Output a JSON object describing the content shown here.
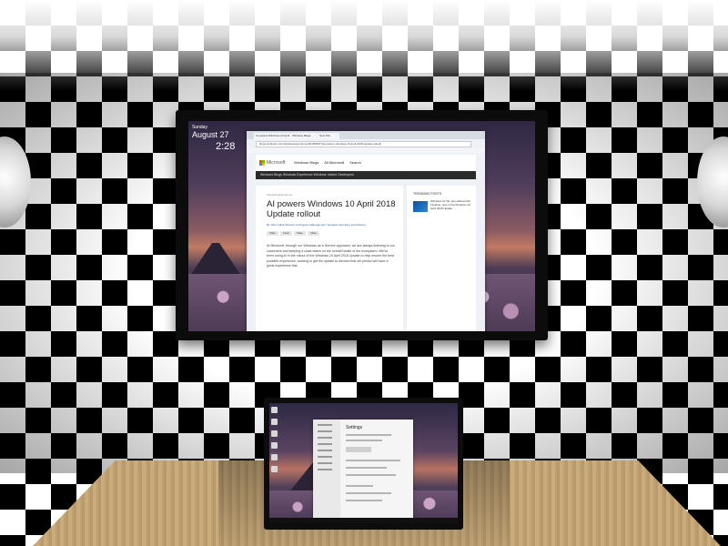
{
  "tv": {
    "lockscreen": {
      "date_small": "Sunday",
      "day": "August 27",
      "time": "2:28"
    },
    "browser": {
      "tabs": [
        "AI powers Windows 10 April",
        "Windows Blogs",
        "New Tab"
      ],
      "address": "blogs.windows.com/windowsexperience/2018/08/27/ai-powers-windows-10-april-2018-update-rollout/",
      "site": {
        "logo_text": "Microsoft",
        "nav": [
          "Windows Blogs",
          "All Microsoft",
          "Search"
        ],
        "blog_bar": "Windows Blogs   Windows Experience   Windows Insider   Developers"
      },
      "article": {
        "category": "Windows Experience",
        "title": "AI powers Windows 10 April 2018 Update rollout",
        "meta": "By John Cable   Director of Program Management, Windows Servicing and Delivery",
        "share": [
          "Share",
          "Tweet",
          "Share",
          "Share"
        ],
        "body": "At Microsoft, through our Windows as a Service approach, we are always listening to our customers and keeping a close watch on the overall health of the ecosystem. We've been using AI in the rollout of the Windows 10 April 2018 Update to help ensure the best possible experience, working to get the update to devices that we predict will have a great experience first."
      },
      "sidebar": {
        "title": "TRENDING POSTS",
        "item": "Windows 10 Tip: Get started with Timeline, new in the Windows 10 April 2018 Update"
      }
    }
  },
  "laptop": {
    "settings": {
      "title": "Settings"
    }
  },
  "colors": {
    "ms_red": "#f25022",
    "ms_green": "#7fba00",
    "ms_blue": "#00a4ef",
    "ms_yellow": "#ffb900"
  }
}
